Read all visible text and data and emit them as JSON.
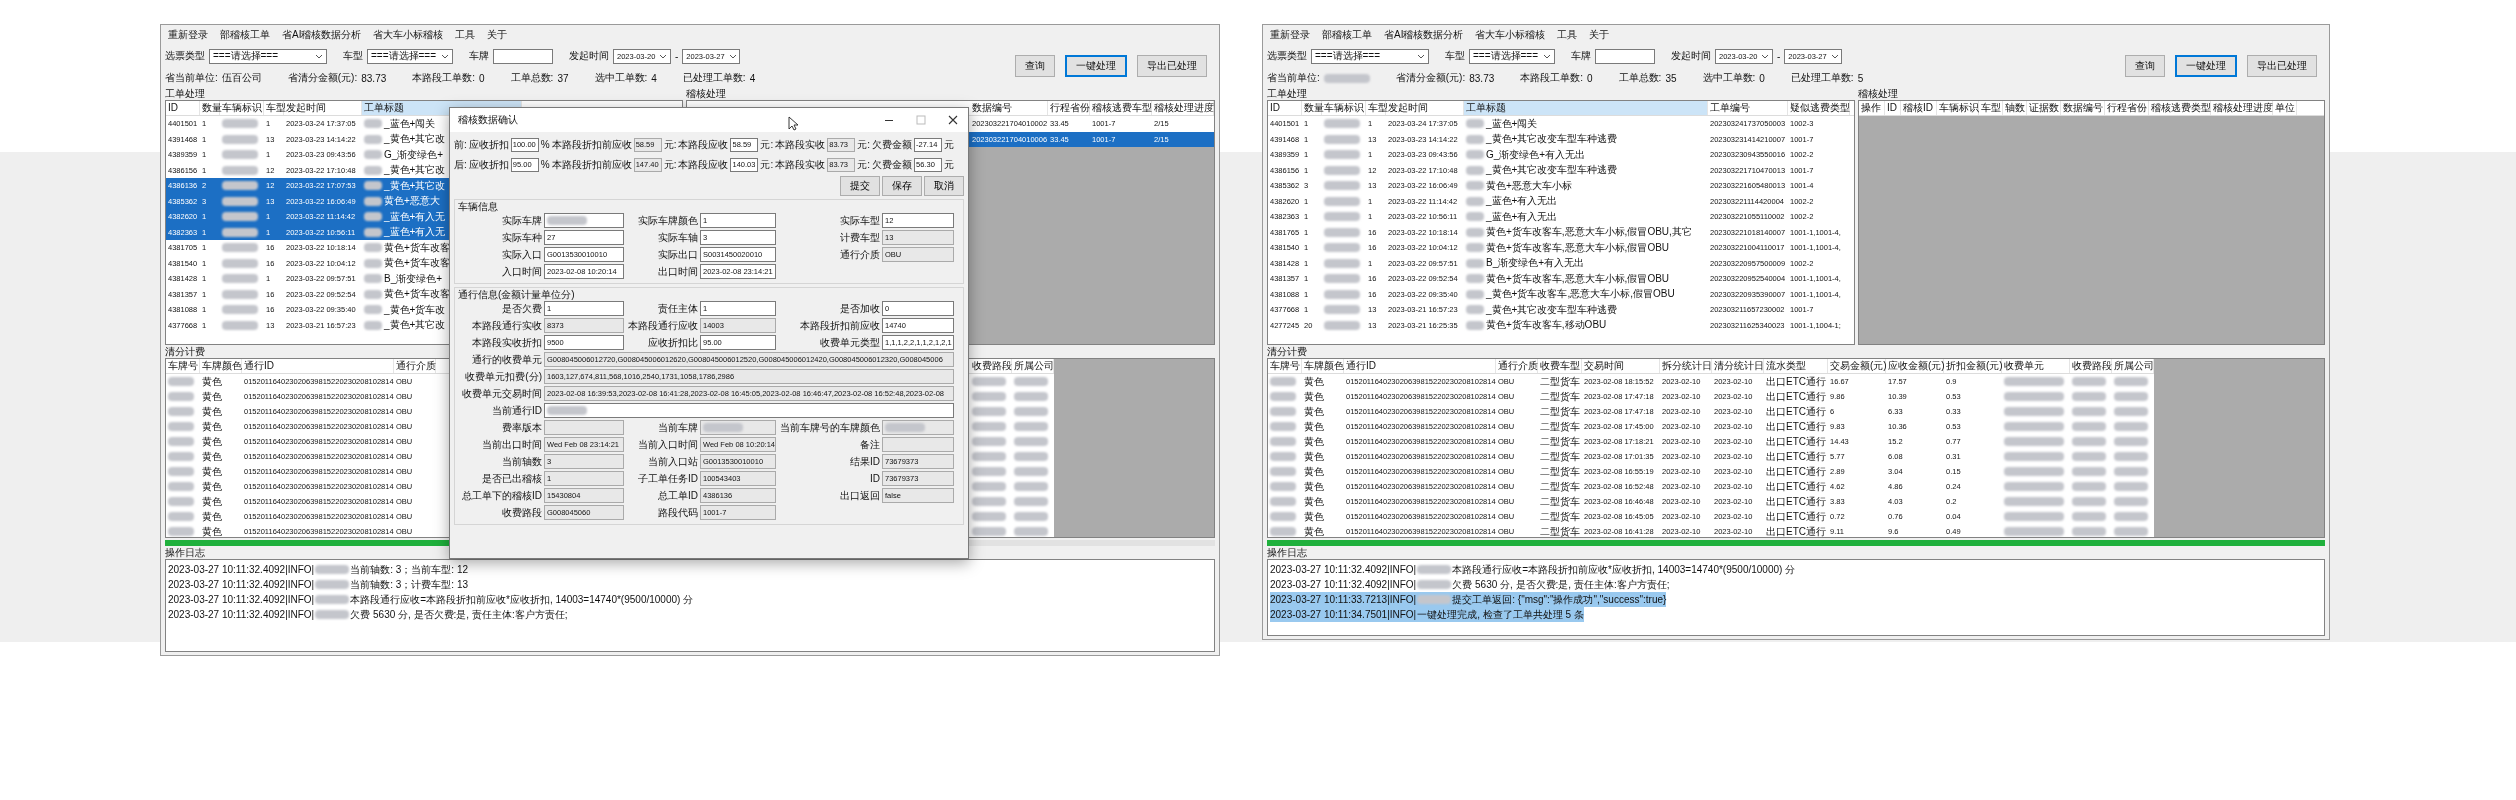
{
  "windows": [
    {
      "menu": [
        "重新登录",
        "部稽核工单",
        "省AI稽核数据分析",
        "省大车小标稽核",
        "工具",
        "关于"
      ],
      "filters": {
        "type_label": "选票类型",
        "type_value": "===请选择===",
        "model_label": "车型",
        "model_value": "===请选择===",
        "plate_label": "车牌",
        "time_label": "发起时间",
        "date_from": "2023-03-20",
        "date_sep": "-",
        "date_to": "2023-03-27"
      },
      "stats": [
        {
          "label": "省当前单位:",
          "value": "伍百公司"
        },
        {
          "label": "省清分金额(元):",
          "value": "83.73"
        },
        {
          "label": "本路段工单数:",
          "value": "0"
        },
        {
          "label": "工单总数:",
          "value": "37"
        },
        {
          "label": "选中工单数:",
          "value": "4"
        },
        {
          "label": "已处理工单数:",
          "value": "4"
        }
      ],
      "buttons": [
        {
          "label": "查询",
          "focused": false
        },
        {
          "label": "一键处理",
          "focused": true
        },
        {
          "label": "导出已处理",
          "focused": false
        }
      ],
      "orders": {
        "title": "工单处理",
        "columns": [
          "ID",
          "数量",
          "车辆标识",
          "车型",
          "发起时间",
          "工单标题"
        ],
        "rows": [
          {
            "selected": false,
            "cells": [
              "4401501",
              "1",
              {
                "redacted": true
              },
              "1",
              "2023-03-24 17:37:05",
              {
                "redacted": true,
                "text": "_蓝色+闯关"
              }
            ]
          },
          {
            "selected": false,
            "cells": [
              "4391468",
              "1",
              {
                "redacted": true
              },
              "13",
              "2023-03-23 14:14:22",
              {
                "redacted": true,
                "text": "_黄色+其它改"
              }
            ]
          },
          {
            "selected": false,
            "cells": [
              "4389359",
              "1",
              {
                "redacted": true
              },
              "1",
              "2023-03-23 09:43:56",
              {
                "redacted": true,
                "text": "G_渐变绿色+"
              }
            ]
          },
          {
            "selected": false,
            "cells": [
              "4386156",
              "1",
              {
                "redacted": true
              },
              "12",
              "2023-03-22 17:10:48",
              {
                "redacted": true,
                "text": "_黄色+其它改"
              }
            ]
          },
          {
            "selected": true,
            "cells": [
              "4386136",
              "2",
              {
                "redacted": true
              },
              "12",
              "2023-03-22 17:07:53",
              {
                "redacted": true,
                "text": "_黄色+其它改"
              }
            ]
          },
          {
            "selected": true,
            "cells": [
              "4385362",
              "3",
              {
                "redacted": true
              },
              "13",
              "2023-03-22 16:06:49",
              {
                "redacted": true,
                "text": "黄色+恶意大"
              }
            ]
          },
          {
            "selected": true,
            "cells": [
              "4382620",
              "1",
              {
                "redacted": true
              },
              "1",
              "2023-03-22 11:14:42",
              {
                "redacted": true,
                "text": "_蓝色+有入无"
              }
            ]
          },
          {
            "selected": true,
            "cells": [
              "4382363",
              "1",
              {
                "redacted": true
              },
              "1",
              "2023-03-22 10:56:11",
              {
                "redacted": true,
                "text": "_蓝色+有入无"
              }
            ]
          },
          {
            "selected": false,
            "cells": [
              "4381705",
              "1",
              {
                "redacted": true
              },
              "16",
              "2023-03-22 10:18:14",
              {
                "redacted": true,
                "text": "黄色+货车改客"
              }
            ]
          },
          {
            "selected": false,
            "cells": [
              "4381540",
              "1",
              {
                "redacted": true
              },
              "16",
              "2023-03-22 10:04:12",
              {
                "redacted": true,
                "text": "黄色+货车改客"
              }
            ]
          },
          {
            "selected": false,
            "cells": [
              "4381428",
              "1",
              {
                "redacted": true
              },
              "1",
              "2023-03-22 09:57:51",
              {
                "redacted": true,
                "text": "B_渐变绿色+"
              }
            ]
          },
          {
            "selected": false,
            "cells": [
              "4381357",
              "1",
              {
                "redacted": true
              },
              "16",
              "2023-03-22 09:52:54",
              {
                "redacted": true,
                "text": "黄色+货车改客"
              }
            ]
          },
          {
            "selected": false,
            "cells": [
              "4381088",
              "1",
              {
                "redacted": true
              },
              "16",
              "2023-03-22 09:35:40",
              {
                "redacted": true,
                "text": "_黄色+货车改"
              }
            ]
          },
          {
            "selected": false,
            "cells": [
              "4377668",
              "1",
              {
                "redacted": true
              },
              "13",
              "2023-03-21 16:57:23",
              {
                "redacted": true,
                "text": "_黄色+其它改"
              }
            ]
          }
        ]
      },
      "audit": {
        "title": "稽核处理",
        "columns": [
          "数据编号",
          "行程省份",
          "稽核逃费车型",
          "稽核处理进度"
        ],
        "rows": [
          {
            "selected": false,
            "cells": [
              "202303221704010002",
              "33.45",
              "1001-7",
              "2/15"
            ]
          },
          {
            "selected": true,
            "cells": [
              "202303221704010006",
              "33.45",
              "1001-7",
              "2/15"
            ]
          }
        ]
      },
      "clearing": {
        "title": "清分计费",
        "columns": [
          "车牌号",
          "车牌颜色",
          "通行ID",
          "通行介质",
          "收费路段",
          "所属公司"
        ],
        "rows": [
          {
            "selected": false,
            "cells": [
              {
                "redacted": true
              },
              "黄色",
              "015201164023020639815220230208102814",
              "OBU",
              {
                "redacted": true
              },
              {
                "redacted": true
              }
            ]
          },
          {
            "selected": false,
            "cells": [
              {
                "redacted": true
              },
              "黄色",
              "015201164023020639815220230208102814",
              "OBU",
              {
                "redacted": true
              },
              {
                "redacted": true
              }
            ]
          },
          {
            "selected": false,
            "cells": [
              {
                "redacted": true
              },
              "黄色",
              "015201164023020639815220230208102814",
              "OBU",
              {
                "redacted": true
              },
              {
                "redacted": true
              }
            ]
          },
          {
            "selected": false,
            "cells": [
              {
                "redacted": true
              },
              "黄色",
              "015201164023020639815220230208102814",
              "OBU",
              {
                "redacted": true
              },
              {
                "redacted": true
              }
            ]
          },
          {
            "selected": false,
            "cells": [
              {
                "redacted": true
              },
              "黄色",
              "015201164023020639815220230208102814",
              "OBU",
              {
                "redacted": true
              },
              {
                "redacted": true
              }
            ]
          },
          {
            "selected": false,
            "cells": [
              {
                "redacted": true
              },
              "黄色",
              "015201164023020639815220230208102814",
              "OBU",
              {
                "redacted": true
              },
              {
                "redacted": true
              }
            ]
          },
          {
            "selected": false,
            "cells": [
              {
                "redacted": true
              },
              "黄色",
              "015201164023020639815220230208102814",
              "OBU",
              {
                "redacted": true
              },
              {
                "redacted": true
              }
            ]
          },
          {
            "selected": false,
            "cells": [
              {
                "redacted": true
              },
              "黄色",
              "015201164023020639815220230208102814",
              "OBU",
              {
                "redacted": true
              },
              {
                "redacted": true
              }
            ]
          },
          {
            "selected": false,
            "cells": [
              {
                "redacted": true
              },
              "黄色",
              "015201164023020639815220230208102814",
              "OBU",
              {
                "redacted": true
              },
              {
                "redacted": true
              }
            ]
          },
          {
            "selected": false,
            "cells": [
              {
                "redacted": true
              },
              "黄色",
              "015201164023020639815220230208102814",
              "OBU",
              {
                "redacted": true
              },
              {
                "redacted": true
              }
            ]
          },
          {
            "selected": false,
            "cells": [
              {
                "redacted": true
              },
              "黄色",
              "015201164023020639815220230208102814",
              "OBU",
              {
                "redacted": true
              },
              {
                "redacted": true
              }
            ]
          }
        ]
      },
      "progress": {
        "level": 0.75
      },
      "log": {
        "title": "操作日志",
        "lines": [
          {
            "prefix": "2023-03-27 10:11:32.4092|INFO|",
            "redacted": true,
            "message": "当前轴数: 3；当前车型: 12",
            "selected": false
          },
          {
            "prefix": "2023-03-27 10:11:32.4092|INFO|",
            "redacted": true,
            "message": "当前轴数: 3；计费车型: 13",
            "selected": false
          },
          {
            "prefix": "2023-03-27 10:11:32.4092|INFO|",
            "redacted": true,
            "message": "本路段通行应收=本路段折扣前应收*应收折扣, 14003=14740*(9500/10000) 分",
            "selected": false
          },
          {
            "prefix": "2023-03-27 10:11:32.4092|INFO|",
            "redacted": true,
            "message": "欠费 5630 分, 是否欠费:是, 责任主体:客户方责任;",
            "selected": false
          }
        ]
      }
    },
    {
      "menu": [
        "重新登录",
        "部稽核工单",
        "省AI稽核数据分析",
        "省大车小标稽核",
        "工具",
        "关于"
      ],
      "filters": {
        "type_label": "选票类型",
        "type_value": "===请选择===",
        "model_label": "车型",
        "model_value": "===请选择===",
        "plate_label": "车牌",
        "time_label": "发起时间",
        "date_from": "2023-03-20",
        "date_sep": "-",
        "date_to": "2023-03-27"
      },
      "stats": [
        {
          "label": "省当前单位:",
          "redacted": true
        },
        {
          "label": "省清分金额(元):",
          "value": "83.73"
        },
        {
          "label": "本路段工单数:",
          "value": "0"
        },
        {
          "label": "工单总数:",
          "value": "35"
        },
        {
          "label": "选中工单数:",
          "value": "0"
        },
        {
          "label": "已处理工单数:",
          "value": "5"
        }
      ],
      "buttons": [
        {
          "label": "查询",
          "focused": false
        },
        {
          "label": "一键处理",
          "focused": true
        },
        {
          "label": "导出已处理",
          "focused": false
        }
      ],
      "orders": {
        "title": "工单处理",
        "columns": [
          "ID",
          "数量",
          "车辆标识",
          "车型",
          "发起时间",
          "工单标题",
          "工单编号",
          "疑似逃费类型"
        ],
        "rows": [
          {
            "selected": false,
            "cells": [
              "4401501",
              "1",
              {
                "redacted": true
              },
              "1",
              "2023-03-24 17:37:05",
              {
                "redacted": true,
                "text": "_蓝色+闯关"
              },
              "202303241737050003",
              "1002-3"
            ]
          },
          {
            "selected": false,
            "cells": [
              "4391468",
              "1",
              {
                "redacted": true
              },
              "13",
              "2023-03-23 14:14:22",
              {
                "redacted": true,
                "text": "_黄色+其它改变车型车种逃费"
              },
              "202303231414210007",
              "1001-7"
            ]
          },
          {
            "selected": false,
            "cells": [
              "4389359",
              "1",
              {
                "redacted": true
              },
              "1",
              "2023-03-23 09:43:56",
              {
                "redacted": true,
                "text": "G_渐变绿色+有入无出"
              },
              "202303230943550016",
              "1002-2"
            ]
          },
          {
            "selected": false,
            "cells": [
              "4386156",
              "1",
              {
                "redacted": true
              },
              "12",
              "2023-03-22 17:10:48",
              {
                "redacted": true,
                "text": "_黄色+其它改变车型车种逃费"
              },
              "202303221710470013",
              "1001-7"
            ]
          },
          {
            "selected": false,
            "cells": [
              "4385362",
              "3",
              {
                "redacted": true
              },
              "13",
              "2023-03-22 16:06:49",
              {
                "redacted": true,
                "text": "黄色+恶意大车小标"
              },
              "202303221605480013",
              "1001-4"
            ]
          },
          {
            "selected": false,
            "cells": [
              "4382620",
              "1",
              {
                "redacted": true
              },
              "1",
              "2023-03-22 11:14:42",
              {
                "redacted": true,
                "text": "_蓝色+有入无出"
              },
              "202303221114420004",
              "1002-2"
            ]
          },
          {
            "selected": false,
            "cells": [
              "4382363",
              "1",
              {
                "redacted": true
              },
              "1",
              "2023-03-22 10:56:11",
              {
                "redacted": true,
                "text": "_蓝色+有入无出"
              },
              "202303221055110002",
              "1002-2"
            ]
          },
          {
            "selected": false,
            "cells": [
              "4381765",
              "1",
              {
                "redacted": true
              },
              "16",
              "2023-03-22 10:18:14",
              {
                "redacted": true,
                "text": "黄色+货车改客车,恶意大车小标,假冒OBU,其它"
              },
              "202303221018140007",
              "1001-1,1001-4,"
            ]
          },
          {
            "selected": false,
            "cells": [
              "4381540",
              "1",
              {
                "redacted": true
              },
              "16",
              "2023-03-22 10:04:12",
              {
                "redacted": true,
                "text": "黄色+货车改客车,恶意大车小标,假冒OBU"
              },
              "202303221004110017",
              "1001-1,1001-4,"
            ]
          },
          {
            "selected": false,
            "cells": [
              "4381428",
              "1",
              {
                "redacted": true
              },
              "1",
              "2023-03-22 09:57:51",
              {
                "redacted": true,
                "text": "B_渐变绿色+有入无出"
              },
              "202303220957500009",
              "1002-2"
            ]
          },
          {
            "selected": false,
            "cells": [
              "4381357",
              "1",
              {
                "redacted": true
              },
              "16",
              "2023-03-22 09:52:54",
              {
                "redacted": true,
                "text": "黄色+货车改客车,恶意大车小标,假冒OBU"
              },
              "202303220952540004",
              "1001-1,1001-4,"
            ]
          },
          {
            "selected": false,
            "cells": [
              "4381088",
              "1",
              {
                "redacted": true
              },
              "16",
              "2023-03-22 09:35:40",
              {
                "redacted": true,
                "text": "_黄色+货车改客车,恶意大车小标,假冒OBU"
              },
              "202303220935390007",
              "1001-1,1001-4,"
            ]
          },
          {
            "selected": false,
            "cells": [
              "4377668",
              "1",
              {
                "redacted": true
              },
              "13",
              "2023-03-21 16:57:23",
              {
                "redacted": true,
                "text": "_黄色+其它改变车型车种逃费"
              },
              "202303211657230002",
              "1001-7"
            ]
          },
          {
            "selected": false,
            "cells": [
              "4277245",
              "20",
              {
                "redacted": true
              },
              "13",
              "2023-03-21 16:25:35",
              {
                "redacted": true,
                "text": "黄色+货车改客车,移动OBU"
              },
              "202303211625340023",
              "1001-1,1004-1;"
            ]
          }
        ]
      },
      "audit": {
        "title": "稽核处理",
        "columns": [
          "操作",
          "ID",
          "稽核ID",
          "车辆标识",
          "车型",
          "轴数",
          "证据数",
          "数据编号",
          "行程省份",
          "稽核逃费类型",
          "稽核处理进度",
          "单位"
        ]
      },
      "clearing": {
        "title": "清分计费",
        "columns": [
          "车牌号",
          "车牌颜色",
          "通行ID",
          "通行介质",
          "收费车型",
          "交易时间",
          "拆分统计日",
          "清分统计日",
          "流水类型",
          "交易金额(元)",
          "应收金额(元)",
          "折扣金额(元)",
          "收费单元",
          "收费路段",
          "所属公司"
        ],
        "rows": [
          {
            "selected": false,
            "cells": [
              {
                "redacted": true
              },
              "黄色",
              "015201164023020639815220230208102814",
              "OBU",
              "二型货车",
              "2023-02-08 18:15:52",
              "2023-02-10",
              "2023-02-10",
              "出口ETC通行",
              "16.67",
              "17.57",
              "0.9",
              {
                "redacted": true
              },
              {
                "redacted": true
              },
              {
                "redacted": true
              }
            ]
          },
          {
            "selected": false,
            "cells": [
              {
                "redacted": true
              },
              "黄色",
              "015201164023020639815220230208102814",
              "OBU",
              "二型货车",
              "2023-02-08 17:47:18",
              "2023-02-10",
              "2023-02-10",
              "出口ETC通行",
              "9.86",
              "10.39",
              "0.53",
              {
                "redacted": true
              },
              {
                "redacted": true
              },
              {
                "redacted": true
              }
            ]
          },
          {
            "selected": false,
            "cells": [
              {
                "redacted": true
              },
              "黄色",
              "015201164023020639815220230208102814",
              "OBU",
              "二型货车",
              "2023-02-08 17:47:18",
              "2023-02-10",
              "2023-02-10",
              "出口ETC通行",
              "6",
              "6.33",
              "0.33",
              {
                "redacted": true
              },
              {
                "redacted": true
              },
              {
                "redacted": true
              }
            ]
          },
          {
            "selected": false,
            "cells": [
              {
                "redacted": true
              },
              "黄色",
              "015201164023020639815220230208102814",
              "OBU",
              "二型货车",
              "2023-02-08 17:45:00",
              "2023-02-10",
              "2023-02-10",
              "出口ETC通行",
              "9.83",
              "10.36",
              "0.53",
              {
                "redacted": true
              },
              {
                "redacted": true
              },
              {
                "redacted": true
              }
            ]
          },
          {
            "selected": false,
            "cells": [
              {
                "redacted": true
              },
              "黄色",
              "015201164023020639815220230208102814",
              "OBU",
              "二型货车",
              "2023-02-08 17:18:21",
              "2023-02-10",
              "2023-02-10",
              "出口ETC通行",
              "14.43",
              "15.2",
              "0.77",
              {
                "redacted": true
              },
              {
                "redacted": true
              },
              {
                "redacted": true
              }
            ]
          },
          {
            "selected": false,
            "cells": [
              {
                "redacted": true
              },
              "黄色",
              "015201164023020639815220230208102814",
              "OBU",
              "二型货车",
              "2023-02-08 17:01:35",
              "2023-02-10",
              "2023-02-10",
              "出口ETC通行",
              "5.77",
              "6.08",
              "0.31",
              {
                "redacted": true
              },
              {
                "redacted": true
              },
              {
                "redacted": true
              }
            ]
          },
          {
            "selected": false,
            "cells": [
              {
                "redacted": true
              },
              "黄色",
              "015201164023020639815220230208102814",
              "OBU",
              "二型货车",
              "2023-02-08 16:55:19",
              "2023-02-10",
              "2023-02-10",
              "出口ETC通行",
              "2.89",
              "3.04",
              "0.15",
              {
                "redacted": true
              },
              {
                "redacted": true
              },
              {
                "redacted": true
              }
            ]
          },
          {
            "selected": false,
            "cells": [
              {
                "redacted": true
              },
              "黄色",
              "015201164023020639815220230208102814",
              "OBU",
              "二型货车",
              "2023-02-08 16:52:48",
              "2023-02-10",
              "2023-02-10",
              "出口ETC通行",
              "4.62",
              "4.86",
              "0.24",
              {
                "redacted": true
              },
              {
                "redacted": true
              },
              {
                "redacted": true
              }
            ]
          },
          {
            "selected": false,
            "cells": [
              {
                "redacted": true
              },
              "黄色",
              "015201164023020639815220230208102814",
              "OBU",
              "二型货车",
              "2023-02-08 16:46:48",
              "2023-02-10",
              "2023-02-10",
              "出口ETC通行",
              "3.83",
              "4.03",
              "0.2",
              {
                "redacted": true
              },
              {
                "redacted": true
              },
              {
                "redacted": true
              }
            ]
          },
          {
            "selected": false,
            "cells": [
              {
                "redacted": true
              },
              "黄色",
              "015201164023020639815220230208102814",
              "OBU",
              "二型货车",
              "2023-02-08 16:45:05",
              "2023-02-10",
              "2023-02-10",
              "出口ETC通行",
              "0.72",
              "0.76",
              "0.04",
              {
                "redacted": true
              },
              {
                "redacted": true
              },
              {
                "redacted": true
              }
            ]
          },
          {
            "selected": false,
            "cells": [
              {
                "redacted": true
              },
              "黄色",
              "015201164023020639815220230208102814",
              "OBU",
              "二型货车",
              "2023-02-08 16:41:28",
              "2023-02-10",
              "2023-02-10",
              "出口ETC通行",
              "9.11",
              "9.6",
              "0.49",
              {
                "redacted": true
              },
              {
                "redacted": true
              },
              {
                "redacted": true
              }
            ]
          }
        ]
      },
      "progress": {
        "level": 1
      },
      "log": {
        "title": "操作日志",
        "lines": [
          {
            "prefix": "2023-03-27 10:11:32.4092|INFO|",
            "redacted": true,
            "message": "本路段通行应收=本路段折扣前应收*应收折扣, 14003=14740*(9500/10000) 分",
            "selected": false
          },
          {
            "prefix": "2023-03-27 10:11:32.4092|INFO|",
            "redacted": true,
            "message": "欠费 5630 分, 是否欠费:是, 责任主体:客户方责任;",
            "selected": false
          },
          {
            "prefix": "2023-03-27 10:11:33.7213|INFO|",
            "redacted": true,
            "message": "提交工单返回: {\"msg\":\"操作成功\",\"success\":true}",
            "selected": true
          },
          {
            "prefix": "2023-03-27 10:11:34.7501|INFO|",
            "message": "一键处理完成, 检查了工单共处理 5 条",
            "selected": true
          }
        ]
      }
    }
  ],
  "dialog": {
    "title": "稽核数据确认",
    "amount_rows": [
      {
        "prefix": "前:",
        "items": [
          {
            "label": "应收折扣",
            "value": "100.00",
            "unit": "%",
            "readonly": false
          },
          {
            "label": "本路段折扣前应收",
            "value": "58.59",
            "unit": "元:",
            "readonly": true
          },
          {
            "label": "本路段应收",
            "value": "58.59",
            "unit": "元:",
            "readonly": false
          },
          {
            "label": "本路段实收",
            "value": "83.73",
            "unit": "元:",
            "readonly": true
          },
          {
            "label": "欠费金额",
            "value": "-27.14",
            "unit": "元",
            "readonly": false
          }
        ]
      },
      {
        "prefix": "后:",
        "items": [
          {
            "label": "应收折扣",
            "value": "95.00",
            "unit": "%",
            "readonly": false
          },
          {
            "label": "本路段折扣前应收",
            "value": "147.40",
            "unit": "元:",
            "readonly": true
          },
          {
            "label": "本路段应收",
            "value": "140.03",
            "unit": "元:",
            "readonly": false
          },
          {
            "label": "本路段实收",
            "value": "83.73",
            "unit": "元:",
            "readonly": true
          },
          {
            "label": "欠费金额",
            "value": "56.30",
            "unit": "元",
            "readonly": false
          }
        ]
      }
    ],
    "buttons": [
      "提交",
      "保存",
      "取消"
    ],
    "groups": [
      {
        "title": "车辆信息",
        "fields": [
          {
            "kind": "cell",
            "label": "实际车牌",
            "redacted": true,
            "readonly": false
          },
          {
            "kind": "cell",
            "label": "实际车牌颜色",
            "value": "1",
            "readonly": false
          },
          {
            "kind": "cell",
            "label": "实际车型",
            "value": "12",
            "readonly": false
          },
          {
            "kind": "cell",
            "label": "实际车种",
            "value": "27",
            "readonly": false
          },
          {
            "kind": "cell",
            "label": "实际车轴",
            "value": "3",
            "readonly": false
          },
          {
            "kind": "cell",
            "label": "计费车型",
            "value": "13",
            "readonly": true
          },
          {
            "kind": "cell",
            "label": "实际入口",
            "value": "G0013530010010",
            "readonly": false
          },
          {
            "kind": "cell",
            "label": "实际出口",
            "value": "S0031450020010",
            "readonly": false
          },
          {
            "kind": "cell",
            "label": "通行介质",
            "value": "OBU",
            "readonly": true
          },
          {
            "kind": "cell",
            "label": "入口时间",
            "value": "2023-02-08 10:20:14",
            "readonly": false
          },
          {
            "kind": "cell",
            "label": "出口时间",
            "value": "2023-02-08 23:14:21",
            "readonly": false
          }
        ]
      },
      {
        "title": "通行信息(金额计量单位分)",
        "fields": [
          {
            "kind": "cell",
            "label": "是否欠费",
            "value": "1",
            "readonly": false
          },
          {
            "kind": "cell",
            "label": "责任主体",
            "value": "1",
            "readonly": false
          },
          {
            "kind": "cell",
            "label": "是否加收",
            "value": "0",
            "readonly": false
          },
          {
            "kind": "cell",
            "label": "本路段通行实收",
            "value": "8373",
            "readonly": true
          },
          {
            "kind": "cell",
            "label": "本路段通行应收",
            "value": "14003",
            "readonly": true
          },
          {
            "kind": "cell",
            "label": "本路段折扣前应收",
            "value": "14740",
            "readonly": false
          },
          {
            "kind": "cell",
            "label": "本路段实收折扣",
            "value": "9500",
            "readonly": false
          },
          {
            "kind": "cell",
            "label": "应收折扣比",
            "value": "95.00",
            "readonly": false
          },
          {
            "kind": "cell",
            "label": "收费单元类型",
            "value": "1,1,1,2,2,1,1,2,1,2,1",
            "readonly": false
          },
          {
            "kind": "wide",
            "label": "通行的收费单元",
            "value": "G008045006012720,G008045006012620,G008045006012520,G008045006012420,G008045006012320,G008045006",
            "readonly": true
          },
          {
            "kind": "wide",
            "label": "收费单元扣费(分)",
            "value": "1603,127,674,811,568,1016,2540,1731,1058,1786,2986",
            "readonly": true
          },
          {
            "kind": "wide",
            "label": "收费单元交易时间",
            "value": "2023-02-08 16:39:53,2023-02-08 16:41:28,2023-02-08 16:45:05,2023-02-08 16:46:47,2023-02-08 16:52:48,2023-02-08",
            "readonly": true
          },
          {
            "kind": "wide",
            "label": "当前通行ID",
            "redacted": true,
            "readonly": false
          },
          {
            "kind": "cell",
            "label": "费率版本",
            "readonly": true
          },
          {
            "kind": "cell",
            "label": "当前车牌",
            "redacted": true,
            "readonly": true
          },
          {
            "kind": "cell",
            "label": "当前车牌号的车牌颜色",
            "redacted": true,
            "readonly": true
          },
          {
            "kind": "cell",
            "label": "当前出口时间",
            "value": "Wed Feb 08 23:14:21",
            "readonly": true
          },
          {
            "kind": "cell",
            "label": "当前入口时间",
            "value": "Wed Feb 08 10:20:14",
            "readonly": true
          },
          {
            "kind": "cell",
            "label": "备注",
            "readonly": true
          },
          {
            "kind": "cell",
            "label": "当前轴数",
            "value": "3",
            "readonly": true
          },
          {
            "kind": "cell",
            "label": "当前入口站",
            "value": "G0013530010010",
            "readonly": true
          },
          {
            "kind": "cell",
            "label": "结果ID",
            "value": "73679373",
            "readonly": true
          },
          {
            "kind": "cell",
            "label": "是否已出稽核",
            "value": "1",
            "readonly": true
          },
          {
            "kind": "cell",
            "label": "子工单任务ID",
            "value": "100543403",
            "readonly": true
          },
          {
            "kind": "cell",
            "label": "ID",
            "value": "73679373",
            "readonly": true
          },
          {
            "kind": "cell",
            "label": "总工单下的稽核ID",
            "value": "15430804",
            "readonly": true
          },
          {
            "kind": "cell",
            "label": "总工单ID",
            "value": "4386136",
            "readonly": true
          },
          {
            "kind": "cell",
            "label": "出口返回",
            "value": "false",
            "readonly": true
          },
          {
            "kind": "cell",
            "label": "收费路段",
            "value": "G008045060",
            "readonly": true
          },
          {
            "kind": "cell",
            "label": "路段代码",
            "value": "1001-7",
            "readonly": true
          }
        ]
      }
    ]
  }
}
